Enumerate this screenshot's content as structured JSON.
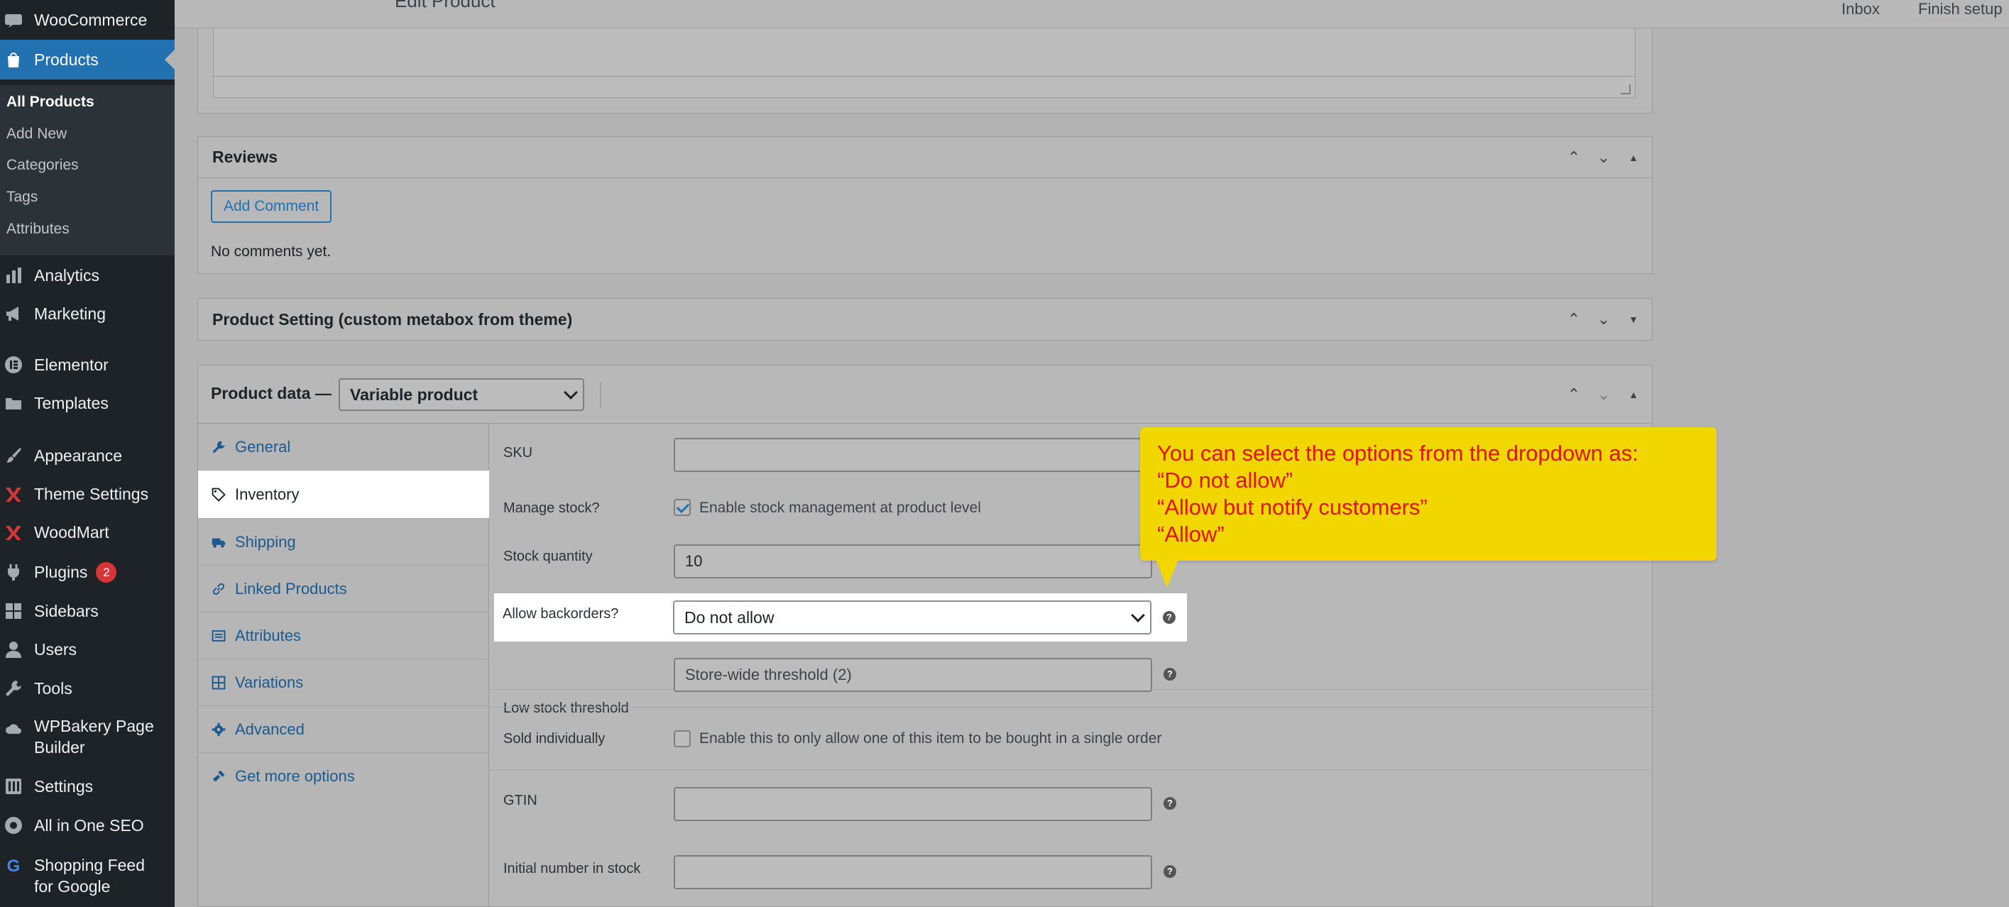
{
  "header": {
    "page_title": "Edit Product",
    "inbox": "Inbox",
    "finish_setup": "Finish setup"
  },
  "sidebar": {
    "woocommerce": "WooCommerce",
    "products": "Products",
    "submenu": [
      "All Products",
      "Add New",
      "Categories",
      "Tags",
      "Attributes"
    ],
    "items": [
      {
        "label": "Analytics",
        "icon": "bar-chart-icon"
      },
      {
        "label": "Marketing",
        "icon": "megaphone-icon"
      },
      {
        "label": "Elementor",
        "icon": "elementor-icon"
      },
      {
        "label": "Templates",
        "icon": "folder-icon"
      },
      {
        "label": "Appearance",
        "icon": "paintbrush-icon"
      },
      {
        "label": "Theme Settings",
        "icon": "theme-settings-icon"
      },
      {
        "label": "WoodMart",
        "icon": "woodmart-icon"
      },
      {
        "label": "Plugins",
        "icon": "plug-icon",
        "badge": "2"
      },
      {
        "label": "Sidebars",
        "icon": "grid-icon"
      },
      {
        "label": "Users",
        "icon": "user-icon"
      },
      {
        "label": "Tools",
        "icon": "wrench-icon"
      },
      {
        "label": "WPBakery Page Builder",
        "label_line1": "WPBakery Page",
        "label_line2": "Builder",
        "icon": "cloud-icon"
      },
      {
        "label": "Settings",
        "icon": "settings-icon"
      },
      {
        "label": "All in One SEO",
        "icon": "seo-icon"
      },
      {
        "label": "Shopping Feed for Google",
        "label_line1": "Shopping Feed",
        "label_line2": "for Google",
        "icon": "google-g-icon"
      }
    ]
  },
  "reviews": {
    "title": "Reviews",
    "add_comment": "Add Comment",
    "empty_text": "No comments yet."
  },
  "product_setting": {
    "title": "Product Setting (custom metabox from theme)"
  },
  "product_data": {
    "title": "Product data —",
    "type_selected": "Variable product",
    "tabs": [
      "General",
      "Inventory",
      "Shipping",
      "Linked Products",
      "Attributes",
      "Variations",
      "Advanced",
      "Get more options"
    ],
    "active_tab": "Inventory",
    "fields": {
      "sku_label": "SKU",
      "sku_value": "",
      "manage_stock_label": "Manage stock?",
      "manage_stock_text": "Enable stock management at product level",
      "manage_stock_checked": true,
      "stock_qty_label": "Stock quantity",
      "stock_qty_value": "10",
      "backorders_label": "Allow backorders?",
      "backorders_value": "Do not allow",
      "low_stock_label": "Low stock threshold",
      "low_stock_placeholder": "Store-wide threshold (2)",
      "sold_individually_label": "Sold individually",
      "sold_individually_text": "Enable this to only allow one of this item to be bought in a single order",
      "gtin_label": "GTIN",
      "initial_stock_label": "Initial number in stock"
    }
  },
  "callout": {
    "lines": [
      "You can select the options from the dropdown as:",
      "“Do not allow”",
      "“Allow but notify customers”",
      "“Allow”"
    ]
  },
  "colors": {
    "sidebar_bg": "#1d2327",
    "accent": "#2271b1",
    "callout_bg": "#f2d600",
    "callout_text": "#e3120b",
    "badge": "#d63638"
  }
}
